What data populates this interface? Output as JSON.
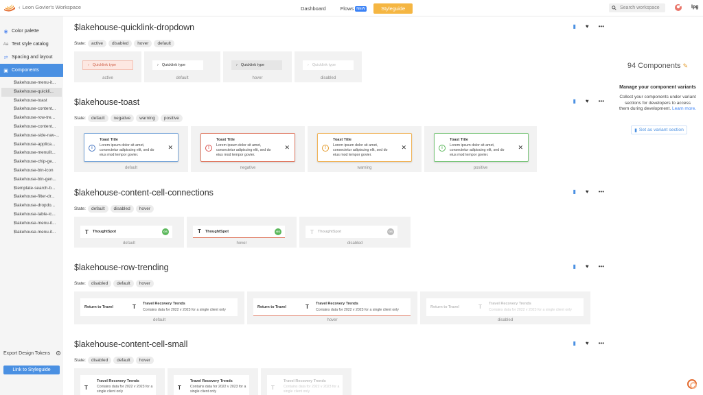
{
  "topbar": {
    "back_label": "Leon Govier's Workspace",
    "nav_dashboard": "Dashboard",
    "nav_flows": "Flows",
    "nav_flows_badge": "NEW",
    "nav_styleguide": "Styleguide",
    "search_placeholder": "Search workspace",
    "user_label": "lpg"
  },
  "sidebar": {
    "color_palette": "Color palette",
    "text_style_catalog": "Text style catalog",
    "text_style_icon": "Aa",
    "spacing_layout": "Spacing and layout",
    "components": "Components",
    "items": [
      "$lakehouse-menu-it...",
      "$lakehouse-quickli...",
      "$lakehouse-toast",
      "$lakehouse-content...",
      "$lakehouse-row-tre...",
      "$lakehouse-content...",
      "$lakehouse-side-nav-...",
      "$lakehouse-applica...",
      "$lakehouse-menulit...",
      "$lakehouse-chip-ge...",
      "$lakehouse-btn-icon",
      "$lakehouse-btn-gen...",
      "$template-search-b...",
      "$lakehouse-filter-dr...",
      "$lakehouse-dropdo...",
      "$lakehouse-table-ic...",
      "$lakehouse-menu-it...",
      "$lakehouse-menu-it..."
    ],
    "export": "Export Design Tokens",
    "link_button": "Link to Styleguide"
  },
  "state_label": "State:",
  "sections": {
    "quicklink": {
      "title": "$lakehouse-quicklink-dropdown",
      "states": [
        "active",
        "disabled",
        "hover",
        "default"
      ],
      "item_label": "Quicklink type",
      "captions": [
        "active",
        "default",
        "hover",
        "disabled"
      ]
    },
    "toast": {
      "title": "$lakehouse-toast",
      "states": [
        "default",
        "negative",
        "warning",
        "positive"
      ],
      "toast_title": "Toast Title",
      "toast_body": "Lorem ipsum dolor sit amet, consectetur adipiscing elit, sed do eius mod tempor govier.",
      "captions": [
        "default",
        "negative",
        "warning",
        "positive"
      ],
      "colors": [
        "#7aa7d9",
        "#e07b64",
        "#f0b45a",
        "#7cc67c"
      ]
    },
    "connections": {
      "title": "$lakehouse-content-cell-connections",
      "states": [
        "default",
        "disabled",
        "hover"
      ],
      "item_label": "ThoughtSpot",
      "badge": "GS",
      "captions": [
        "default",
        "hover",
        "disabled"
      ]
    },
    "trending": {
      "title": "$lakehouse-row-trending",
      "states": [
        "disabled",
        "default",
        "hover"
      ],
      "left_label": "Return to Travel",
      "item_title": "Travel Recovery Trends",
      "item_desc": "Contains data for 2022 v 2023 for a single client only",
      "captions": [
        "default",
        "hover",
        "disabled"
      ]
    },
    "small": {
      "title": "$lakehouse-content-cell-small",
      "states": [
        "disabled",
        "default",
        "hover"
      ],
      "item_title": "Travel Recovery Trends",
      "item_desc": "Contains data for 2022 v 2023 for a single client only"
    }
  },
  "right_panel": {
    "count": "94 Components",
    "heading": "Manage your component variants",
    "body": "Collect your components under variant sections for developers to access them during development.",
    "learn_more": "Learn more.",
    "button": "Set as variant section"
  },
  "actions": {
    "more": "•••"
  }
}
